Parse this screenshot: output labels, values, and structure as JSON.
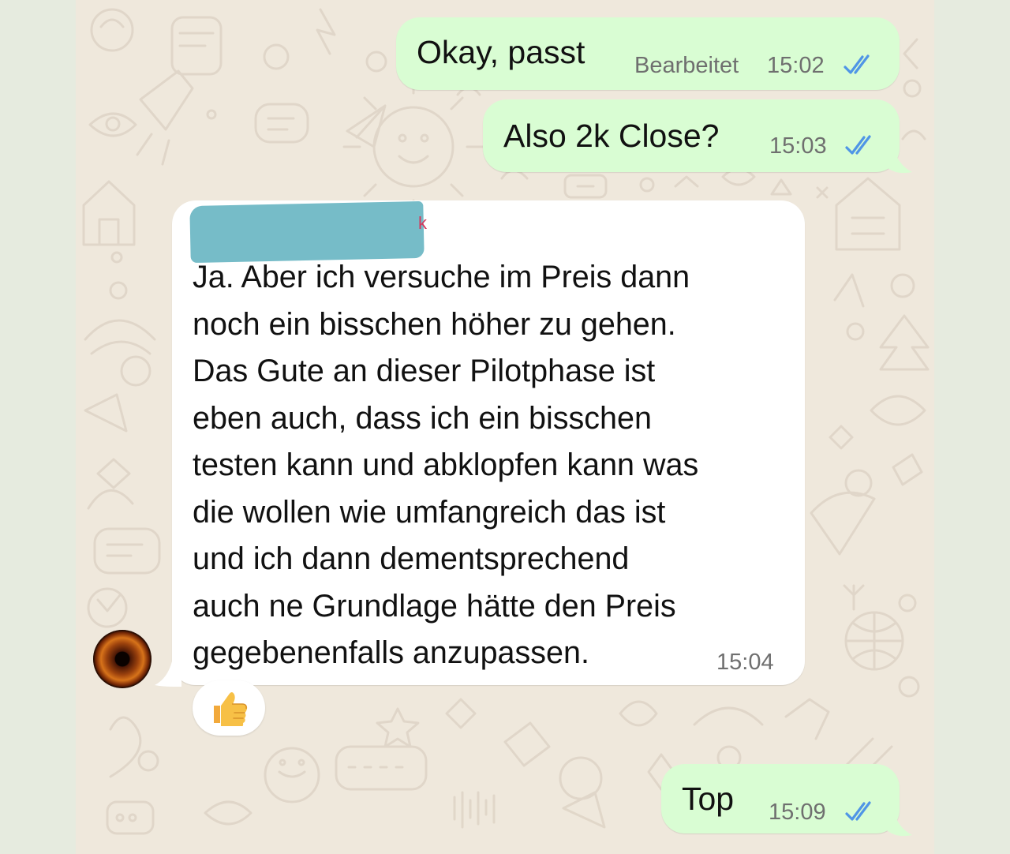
{
  "chat": {
    "messages": [
      {
        "id": "msg1",
        "direction": "outgoing",
        "text": "Okay, passt",
        "edited_label": "Bearbeitet",
        "time": "15:02",
        "status": "read"
      },
      {
        "id": "msg2",
        "direction": "outgoing",
        "text": "Also 2k Close?",
        "time": "15:03",
        "status": "read"
      },
      {
        "id": "msg3",
        "direction": "incoming",
        "sender_name_redacted": true,
        "lines": [
          "Ja. Aber ich versuche im Preis dann",
          "noch ein bisschen höher zu gehen.",
          "Das Gute an dieser Pilotphase ist",
          "eben auch, dass ich ein bisschen",
          "testen kann und abklopfen kann was",
          "die wollen wie umfangreich das ist",
          "und ich dann dementsprechend",
          "auch ne Grundlage hätte den Preis",
          "gegebenenfalls anzupassen."
        ],
        "time": "15:04",
        "reaction_icon": "thumbs-up-icon"
      },
      {
        "id": "msg4",
        "direction": "outgoing",
        "text": "Top",
        "time": "15:09",
        "status": "read"
      }
    ]
  },
  "icons": {
    "read_ticks": "double-check-icon",
    "avatar": "eye-avatar",
    "reaction": "thumbs-up-icon"
  },
  "colors": {
    "outgoing_bubble": "#d9fdd3",
    "incoming_bubble": "#ffffff",
    "chat_background": "#efe8dc",
    "outer_background": "#e6ebdf",
    "read_tick": "#4f95e6",
    "redaction": "#76bcc8",
    "meta_text": "#6f6f6f"
  }
}
